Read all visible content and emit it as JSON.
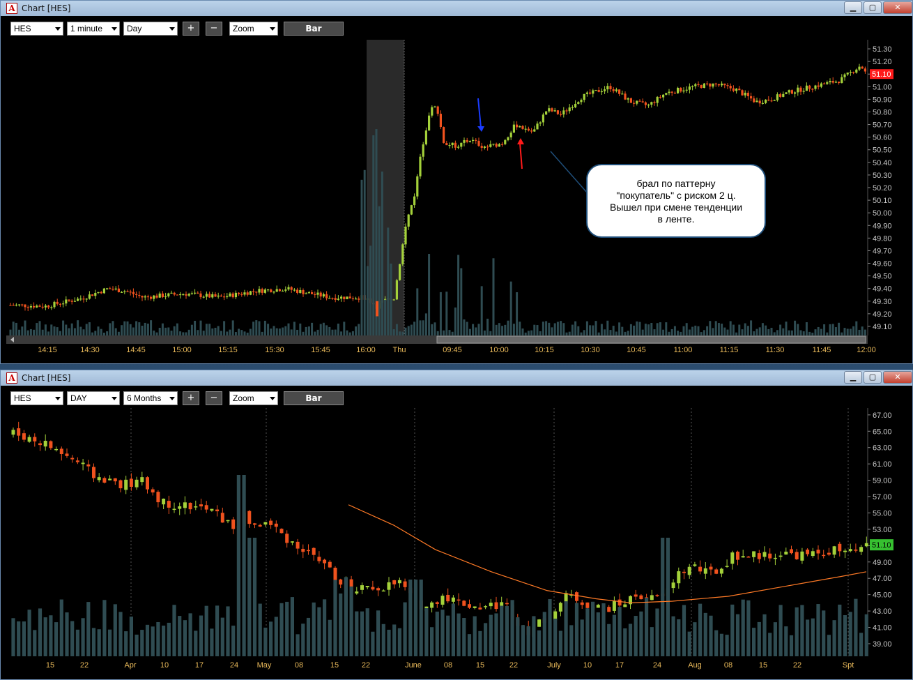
{
  "desktop_icons": [
    "app-icon-1",
    "app-icon-2",
    "app-icon-3",
    "app-icon-4",
    "app-icon-5",
    "app-icon-6"
  ],
  "top_window": {
    "title": "Chart [HES]",
    "symbol": "HES",
    "interval": "1 minute",
    "period": "Day",
    "plus": "+",
    "minus": "−",
    "zoom": "Zoom",
    "bar": "Bar",
    "price_ticks": [
      "51.30",
      "51.20",
      "51.10",
      "51.00",
      "50.90",
      "50.80",
      "50.70",
      "50.60",
      "50.50",
      "50.40",
      "50.30",
      "50.20",
      "50.10",
      "50.00",
      "49.90",
      "49.80",
      "49.70",
      "49.60",
      "49.50",
      "49.40",
      "49.30",
      "49.20",
      "49.10"
    ],
    "time_ticks": [
      "14:15",
      "14:30",
      "14:45",
      "15:00",
      "15:15",
      "15:30",
      "15:45",
      "16:00",
      "Thu",
      "09:45",
      "10:00",
      "10:15",
      "10:30",
      "10:45",
      "11:00",
      "11:15",
      "11:30",
      "11:45",
      "12:00"
    ],
    "last_price": "51.10",
    "annotation": [
      "брал по паттерну",
      "\"покупатель\" с риском 2 ц.",
      "Вышел при смене тенденции",
      "в ленте."
    ]
  },
  "bottom_window": {
    "title": "Chart [HES]",
    "symbol": "HES",
    "interval": "DAY",
    "period": "6 Months",
    "plus": "+",
    "minus": "−",
    "zoom": "Zoom",
    "bar": "Bar",
    "price_ticks": [
      "67.00",
      "65.00",
      "63.00",
      "61.00",
      "59.00",
      "57.00",
      "55.00",
      "53.00",
      "51.00",
      "49.00",
      "47.00",
      "45.00",
      "43.00",
      "41.00",
      "39.00"
    ],
    "date_ticks": [
      "15",
      "22",
      "Apr",
      "10",
      "17",
      "24",
      "May",
      "08",
      "15",
      "22",
      "June",
      "08",
      "15",
      "22",
      "July",
      "10",
      "17",
      "24",
      "Aug",
      "08",
      "15",
      "22",
      "Spt"
    ],
    "last_price": "51.10"
  },
  "colors": {
    "up": "#a4d13a",
    "down": "#f0521e",
    "volume": "#2f4c52",
    "axis_text": "#c8c8c8",
    "time_text": "#e8b95a",
    "ma": "#ff7a26",
    "last_red": "#ff1a1a",
    "last_green": "#36c030"
  },
  "chart_data": [
    {
      "type": "candlestick",
      "title": "Chart [HES]",
      "interval": "1 minute",
      "ylim": [
        49.05,
        51.35
      ],
      "x": [
        "14:15",
        "14:30",
        "14:45",
        "15:00",
        "15:15",
        "15:30",
        "15:45",
        "16:00",
        "Thu",
        "09:45",
        "10:00",
        "10:15",
        "10:30",
        "10:45",
        "11:00",
        "11:15",
        "11:30",
        "11:45",
        "12:00"
      ],
      "close": [
        49.27,
        49.32,
        49.4,
        49.35,
        49.34,
        49.38,
        49.34,
        49.33,
        49.95,
        50.52,
        50.52,
        50.8,
        50.98,
        50.93,
        51.02,
        50.94,
        50.9,
        51.05,
        51.1
      ],
      "last": 51.1
    },
    {
      "type": "candlestick",
      "title": "Chart [HES]",
      "interval": "DAY",
      "ylim": [
        37.8,
        67.5
      ],
      "x": [
        "15",
        "22",
        "Apr",
        "10",
        "17",
        "24",
        "May",
        "08",
        "15",
        "22",
        "June",
        "08",
        "15",
        "22",
        "July",
        "10",
        "17",
        "24",
        "Aug",
        "08",
        "15",
        "22",
        "Spt"
      ],
      "close": [
        64.5,
        62.5,
        59.0,
        56.5,
        55.5,
        54.0,
        53.0,
        49.5,
        46.5,
        46.2,
        43.8,
        44.5,
        43.8,
        40.5,
        42.5,
        43.0,
        44.5,
        45.5,
        48.5,
        49.8,
        50.0,
        49.8,
        50.0
      ],
      "moving_average": {
        "start": [
          20,
          53.8
        ],
        "points": [
          [
            20,
            53.8
          ],
          [
            40,
            48.5
          ],
          [
            60,
            45.8
          ],
          [
            80,
            44.2
          ],
          [
            100,
            44.5
          ],
          [
            120,
            45.5
          ],
          [
            140,
            46.8
          ]
        ]
      },
      "last": 51.1
    }
  ]
}
